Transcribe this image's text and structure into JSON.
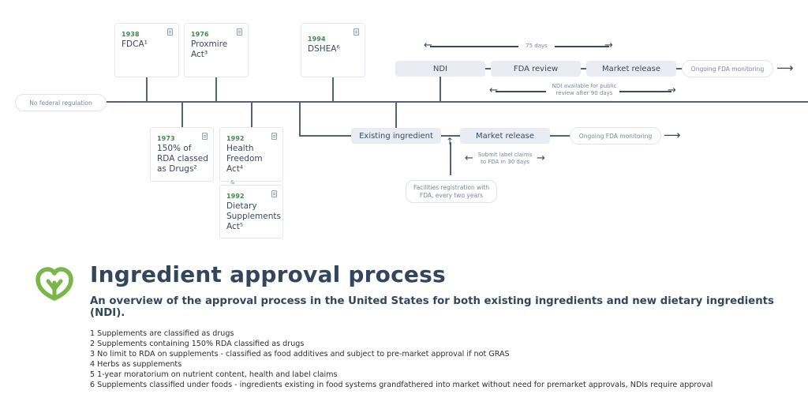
{
  "timeline": {
    "start_label": "No federal regulation",
    "events_above": [
      {
        "year": "1938",
        "title": "FDCA¹"
      },
      {
        "year": "1976",
        "title": "Proxmire Act³"
      },
      {
        "year": "1994",
        "title": "DSHEA⁶"
      }
    ],
    "events_below": [
      {
        "year": "1973",
        "title": "150% of RDA classed as Drugs²"
      },
      {
        "year": "1992",
        "title": "Health Freedom Act⁴"
      },
      {
        "year": "1992",
        "title": "Dietary Supplements Act⁵"
      }
    ],
    "joiner": "&"
  },
  "ndi_flow": {
    "span_label": "75 days",
    "steps": [
      "NDI",
      "FDA review",
      "Market release"
    ],
    "ongoing": "Ongoing FDA monitoring",
    "public_review_note_line1": "NDI available for public",
    "public_review_note_line2": "review after 90 days"
  },
  "existing_flow": {
    "steps": [
      "Existing ingredient",
      "Market release"
    ],
    "ongoing": "Ongoing FDA monitoring",
    "label_claims_line1": "Submit label claims",
    "label_claims_line2": "to FDA in 30 days",
    "facilities_line1": "Facilities registration with",
    "facilities_line2": "FDA, every two years"
  },
  "header": {
    "title": "Ingredient approval process",
    "subtitle": "An overview of the approval process in the United States for both existing ingredients and new dietary ingredients (NDI).",
    "logo_icon": "leaf-heart-icon",
    "brand_color": "#7ab648"
  },
  "footnotes": [
    "1 Supplements are classified as drugs",
    "2 Supplements containing 150% RDA classified as drugs",
    "3 No limit to RDA on supplements - classified as food additives and subject to pre-market approval if not GRAS",
    "4 Herbs as supplements",
    "5 1-year moratorium on nutrient content, health and label claims",
    "6 Supplements classified under foods - ingredients existing in food systems grandfathered into market without need for premarket approvals, NDIs require approval"
  ]
}
